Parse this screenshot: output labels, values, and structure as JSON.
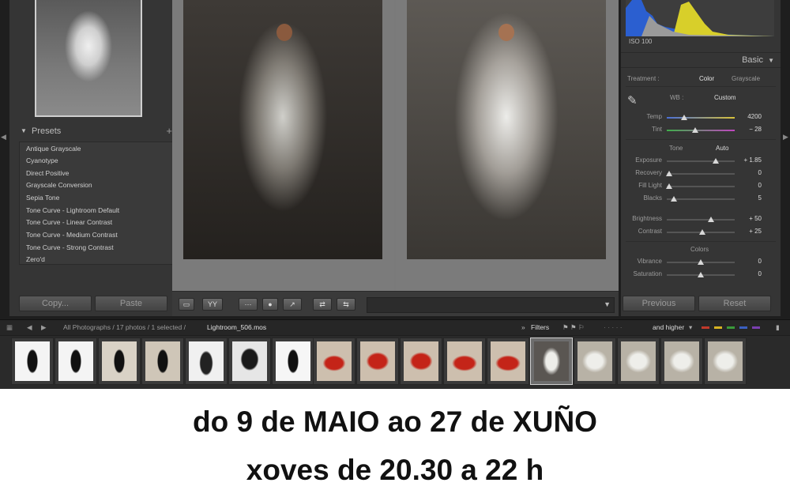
{
  "left_panel": {
    "presets_title": "Presets",
    "presets_add": "+",
    "presets": [
      "Antique Grayscale",
      "Cyanotype",
      "Direct Positive",
      "Grayscale Conversion",
      "Sepia Tone",
      "Tone Curve - Lightroom Default",
      "Tone Curve - Linear Contrast",
      "Tone Curve - Medium Contrast",
      "Tone Curve - Strong Contrast",
      "Zero'd"
    ],
    "copy_label": "Copy...",
    "paste_label": "Paste"
  },
  "toolbar": {
    "view_label": "YY"
  },
  "right_panel": {
    "iso": "ISO 100",
    "basic_title": "Basic",
    "treatment_label": "Treatment :",
    "treatment_color": "Color",
    "treatment_grayscale": "Grayscale",
    "wb_label": "WB :",
    "wb_value": "Custom",
    "temp": {
      "label": "Temp",
      "value": "4200",
      "level": 0.25
    },
    "tint": {
      "label": "Tint",
      "value": "− 28",
      "level": 0.42
    },
    "tone_label": "Tone",
    "tone_auto": "Auto",
    "exposure": {
      "label": "Exposure",
      "value": "+ 1.85",
      "level": 0.72
    },
    "recovery": {
      "label": "Recovery",
      "value": "0",
      "level": 0.04
    },
    "fill_light": {
      "label": "Fill Light",
      "value": "0",
      "level": 0.04
    },
    "blacks": {
      "label": "Blacks",
      "value": "5",
      "level": 0.1
    },
    "brightness": {
      "label": "Brightness",
      "value": "+ 50",
      "level": 0.65
    },
    "contrast": {
      "label": "Contrast",
      "value": "+ 25",
      "level": 0.52
    },
    "colors_label": "Colors",
    "vibrance": {
      "label": "Vibrance",
      "value": "0",
      "level": 0.5
    },
    "saturation": {
      "label": "Saturation",
      "value": "0",
      "level": 0.5
    },
    "previous_label": "Previous",
    "reset_label": "Reset",
    "colors": {
      "temp_left": "#4a6fd6",
      "temp_right": "#d9c23a",
      "tint_left": "#3fae4a",
      "tint_right": "#c046c0"
    }
  },
  "pathbar": {
    "path": "All Photographs / 17 photos / 1 selected / ",
    "filename": "Lightroom_506.mos",
    "filters_label": "Filters",
    "rating_label": "and higher",
    "color_labels": [
      "#c0392b",
      "#d6b322",
      "#3a9a3a",
      "#3a5fc0",
      "#7a3fb0"
    ]
  },
  "caption": {
    "line1": "do 9 de MAIO ao  27 de XUÑO",
    "line2": "xoves  de 20.30 a 22 h"
  }
}
